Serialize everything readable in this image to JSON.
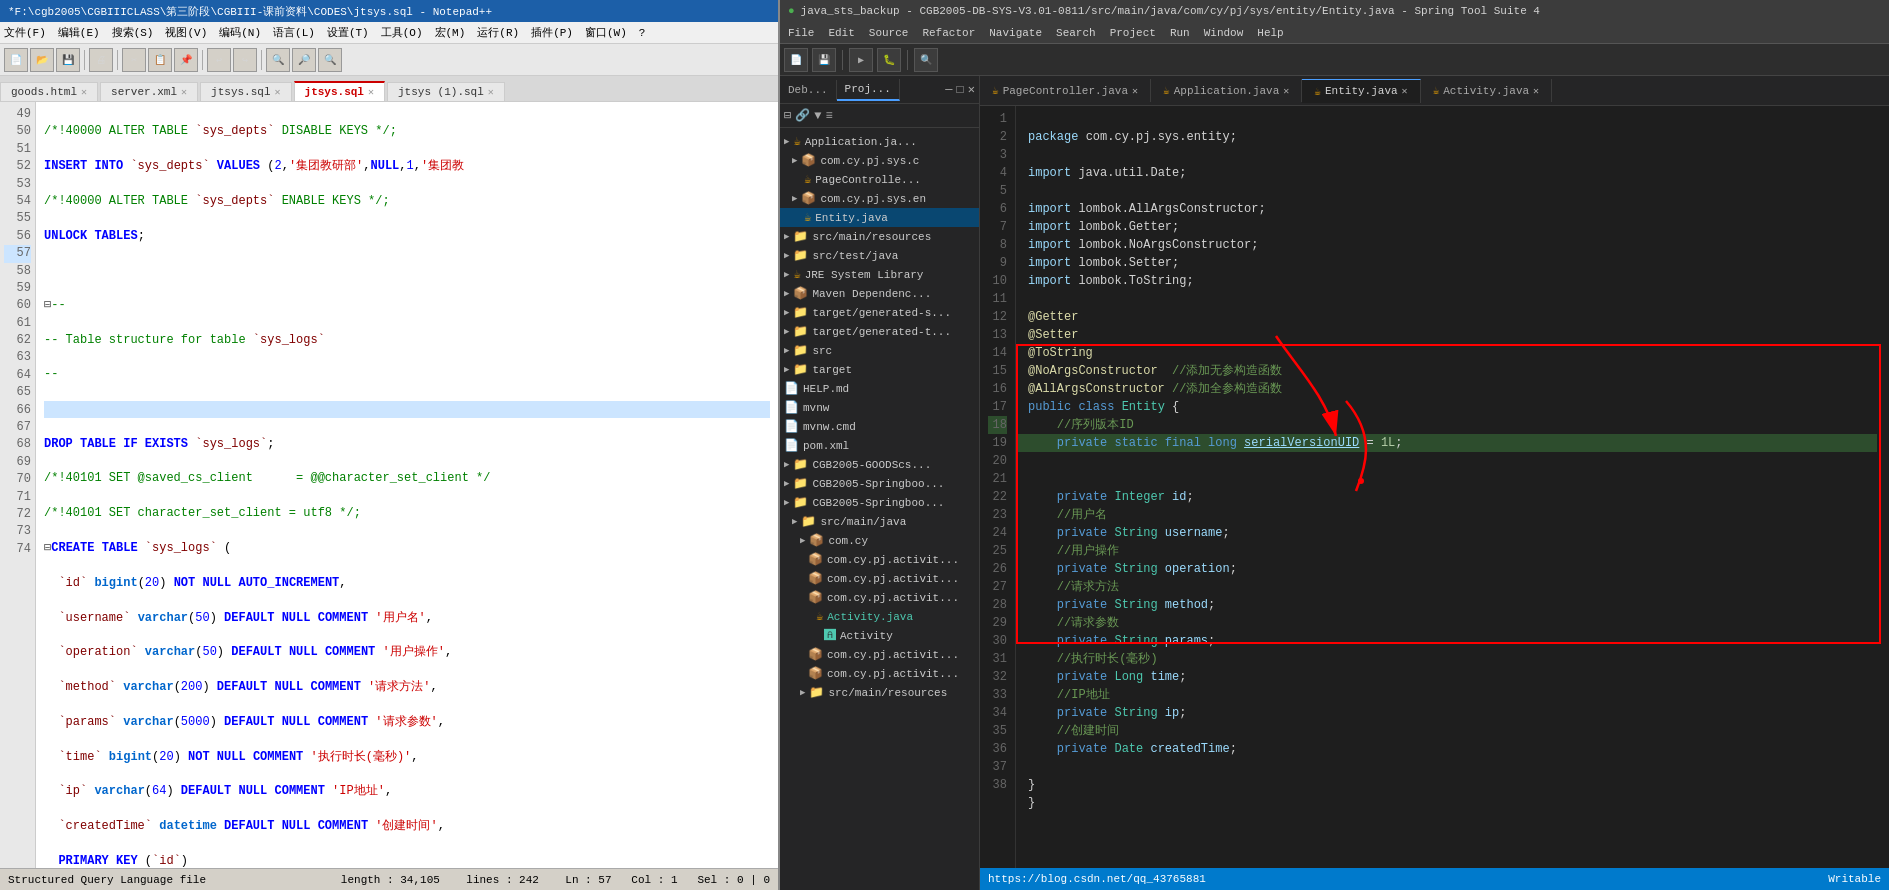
{
  "leftPanel": {
    "titlebar": "*F:\\cgb2005\\CGBIIICLASS\\第三阶段\\CGBIII-课前资料\\CODES\\jtsys.sql - Notepad++",
    "menu": [
      "文件(F)",
      "编辑(E)",
      "搜索(S)",
      "视图(V)",
      "编码(N)",
      "语言(L)",
      "设置(T)",
      "工具(O)",
      "宏(M)",
      "运行(R)",
      "插件(P)",
      "窗口(W)",
      "?"
    ],
    "tabs": [
      {
        "label": "goods.html",
        "active": false
      },
      {
        "label": "server.xml",
        "active": false
      },
      {
        "label": "jtsys.sql",
        "active": false
      },
      {
        "label": "jtsys.sql",
        "active": true,
        "color": "red"
      },
      {
        "label": "jtsys (1).sql",
        "active": false
      }
    ],
    "statusbar": {
      "filetype": "Structured Query Language file",
      "length": "length : 34,105",
      "lines": "lines : 242",
      "ln": "Ln : 57",
      "col": "Col : 1",
      "sel": "Sel : 0 | 0"
    },
    "codeLines": [
      {
        "num": "49",
        "content": "/*!40000 ALTER TABLE `sys_depts` DISABLE KEYS */;",
        "type": "comment"
      },
      {
        "num": "50",
        "content": "INSERT INTO `sys_depts` VALUES (2,'集团教研部',NULL,1,'集团教",
        "type": "mixed"
      },
      {
        "num": "51",
        "content": "/*!40000 ALTER TABLE `sys_depts` ENABLE KEYS */;",
        "type": "comment"
      },
      {
        "num": "52",
        "content": "UNLOCK TABLES;",
        "type": "kw"
      },
      {
        "num": "53",
        "content": "",
        "type": "blank"
      },
      {
        "num": "54",
        "content": "--",
        "type": "comment",
        "fold": true
      },
      {
        "num": "55",
        "content": "-- Table structure for table `sys_logs`",
        "type": "comment"
      },
      {
        "num": "56",
        "content": "--",
        "type": "comment"
      },
      {
        "num": "57",
        "content": "",
        "type": "blank",
        "highlighted": true
      },
      {
        "num": "58",
        "content": "DROP TABLE IF EXISTS `sys_logs`;",
        "type": "kw"
      },
      {
        "num": "59",
        "content": "/*!40101 SET @saved_cs_client      = @@character_set_client */",
        "type": "comment"
      },
      {
        "num": "60",
        "content": "/*!40101 SET character_set_client = utf8 */;",
        "type": "comment"
      },
      {
        "num": "61",
        "content": "CREATE TABLE `sys_logs` (",
        "type": "kw",
        "fold": true
      },
      {
        "num": "62",
        "content": "  `id` bigint(20) NOT NULL AUTO_INCREMENT,",
        "type": "field"
      },
      {
        "num": "63",
        "content": "  `username` varchar(50) DEFAULT NULL COMMENT '用户名',",
        "type": "field"
      },
      {
        "num": "64",
        "content": "  `operation` varchar(50) DEFAULT NULL COMMENT '用户操作',",
        "type": "field"
      },
      {
        "num": "65",
        "content": "  `method` varchar(200) DEFAULT NULL COMMENT '请求方法',",
        "type": "field"
      },
      {
        "num": "66",
        "content": "  `params` varchar(5000) DEFAULT NULL COMMENT '请求参数',",
        "type": "field"
      },
      {
        "num": "67",
        "content": "  `time` bigint(20) NOT NULL COMMENT '执行时长(毫秒)',",
        "type": "field"
      },
      {
        "num": "68",
        "content": "  `ip` varchar(64) DEFAULT NULL COMMENT 'IP地址',",
        "type": "field"
      },
      {
        "num": "69",
        "content": "  `createdTime` datetime DEFAULT NULL COMMENT '创建时间',",
        "type": "field"
      },
      {
        "num": "70",
        "content": "  PRIMARY KEY (`id`)",
        "type": "field"
      },
      {
        "num": "71",
        "content": ") ENGINE=InnoDB AUTO_INCREMENT=175 DEFAULT CHARSET=utf8 COMME",
        "type": "field"
      },
      {
        "num": "72",
        "content": "/*!40101 SET character_set_client = @saved_cs_client */;",
        "type": "comment"
      },
      {
        "num": "73",
        "content": "",
        "type": "blank"
      },
      {
        "num": "74",
        "content": "--",
        "type": "comment",
        "fold": true
      }
    ]
  },
  "rightPanel": {
    "titlebar": "java_sts_backup - CGB2005-DB-SYS-V3.01-0811/src/main/java/com/cy/pj/sys/entity/Entity.java - Spring Tool Suite 4",
    "menu": [
      "File",
      "Edit",
      "Source",
      "Refactor",
      "Navigate",
      "Search",
      "Project",
      "Run",
      "Window",
      "Help"
    ],
    "editorTabs": [
      {
        "label": "Deb...",
        "active": false
      },
      {
        "label": "Proj...",
        "active": false
      },
      {
        "label": "PageController.java",
        "active": false
      },
      {
        "label": "Application.java",
        "active": false
      },
      {
        "label": "Entity.java",
        "active": true
      },
      {
        "label": "Activity.java",
        "active": false
      }
    ],
    "projectTree": [
      {
        "level": 0,
        "label": "Application.ja...",
        "icon": "📄",
        "expanded": false
      },
      {
        "level": 1,
        "label": "com.cy.pj.sys.c",
        "icon": "📁",
        "expanded": false
      },
      {
        "level": 2,
        "label": "PageControlle...",
        "icon": "📄"
      },
      {
        "level": 1,
        "label": "com.cy.pj.sys.en",
        "icon": "📁",
        "expanded": false
      },
      {
        "level": 2,
        "label": "Entity.java",
        "icon": "📄",
        "active": true
      },
      {
        "level": 0,
        "label": "src/main/resources",
        "icon": "📁",
        "expanded": false
      },
      {
        "level": 0,
        "label": "src/test/java",
        "icon": "📁",
        "expanded": false
      },
      {
        "level": 0,
        "label": "JRE System Library",
        "icon": "📁"
      },
      {
        "level": 0,
        "label": "Maven Dependenc...",
        "icon": "📁"
      },
      {
        "level": 0,
        "label": "target/generated-s...",
        "icon": "📁"
      },
      {
        "level": 0,
        "label": "target/generated-t...",
        "icon": "📁"
      },
      {
        "level": 0,
        "label": "src",
        "icon": "📁"
      },
      {
        "level": 0,
        "label": "target",
        "icon": "📁"
      },
      {
        "level": 0,
        "label": "HELP.md",
        "icon": "📄"
      },
      {
        "level": 0,
        "label": "mvnw",
        "icon": "📄"
      },
      {
        "level": 0,
        "label": "mvnw.cmd",
        "icon": "📄"
      },
      {
        "level": 0,
        "label": "pom.xml",
        "icon": "📄"
      },
      {
        "level": 0,
        "label": "CGB2005-GOODScs...",
        "icon": "📁"
      },
      {
        "level": 0,
        "label": "CGB2005-Springboo...",
        "icon": "📁"
      },
      {
        "level": 0,
        "label": "CGB2005-Springboo...",
        "icon": "📁"
      },
      {
        "level": 1,
        "label": "src/main/java",
        "icon": "📁",
        "expanded": true
      },
      {
        "level": 2,
        "label": "com.cy",
        "icon": "📁",
        "expanded": false
      },
      {
        "level": 3,
        "label": "com.cy.pj.activit...",
        "icon": "📁"
      },
      {
        "level": 3,
        "label": "com.cy.pj.activit...",
        "icon": "📁"
      },
      {
        "level": 3,
        "label": "com.cy.pj.activit...",
        "icon": "📁"
      },
      {
        "level": 3,
        "label": "Activity.java",
        "icon": "📄",
        "selected": true
      },
      {
        "level": 4,
        "label": "Activity",
        "icon": "🅰"
      },
      {
        "level": 3,
        "label": "com.cy.pj.activit...",
        "icon": "📁"
      },
      {
        "level": 3,
        "label": "com.cy.pj.activit...",
        "icon": "📁"
      },
      {
        "level": 1,
        "label": "src/main/resources",
        "icon": "📁"
      }
    ],
    "javaCode": [
      {
        "num": "1",
        "content": "package com.cy.pj.sys.entity;"
      },
      {
        "num": "2",
        "content": ""
      },
      {
        "num": "3",
        "content": "import java.util.Date;"
      },
      {
        "num": "4",
        "content": ""
      },
      {
        "num": "5",
        "content": "import lombok.AllArgsConstructor;"
      },
      {
        "num": "6",
        "content": "import lombok.Getter;"
      },
      {
        "num": "7",
        "content": "import lombok.NoArgsConstructor;"
      },
      {
        "num": "8",
        "content": "import lombok.Setter;"
      },
      {
        "num": "9",
        "content": "import lombok.ToString;"
      },
      {
        "num": "10",
        "content": ""
      },
      {
        "num": "11",
        "content": "@Getter"
      },
      {
        "num": "12",
        "content": "@Setter"
      },
      {
        "num": "13",
        "content": "@ToString"
      },
      {
        "num": "14",
        "content": "@NoArgsConstructor  //添加无参构造函数"
      },
      {
        "num": "15",
        "content": "@AllArgsConstructor //添加全参构造函数"
      },
      {
        "num": "16",
        "content": "public class Entity {"
      },
      {
        "num": "17",
        "content": "    //序列版本ID"
      },
      {
        "num": "18",
        "content": "    private static final long serialVersionUID = 1L;",
        "highlighted": true
      },
      {
        "num": "19",
        "content": ""
      },
      {
        "num": "20",
        "content": "    private Integer id;"
      },
      {
        "num": "21",
        "content": "    //用户名"
      },
      {
        "num": "22",
        "content": "    private String username;"
      },
      {
        "num": "23",
        "content": "    //用户操作"
      },
      {
        "num": "24",
        "content": "    private String operation;"
      },
      {
        "num": "25",
        "content": "    //请求方法"
      },
      {
        "num": "26",
        "content": "    private String method;"
      },
      {
        "num": "27",
        "content": "    //请求参数"
      },
      {
        "num": "28",
        "content": "    private String params;"
      },
      {
        "num": "29",
        "content": "    //执行时长(毫秒)"
      },
      {
        "num": "30",
        "content": "    private Long time;"
      },
      {
        "num": "31",
        "content": "    //IP地址"
      },
      {
        "num": "32",
        "content": "    private String ip;"
      },
      {
        "num": "33",
        "content": "    //创建时间"
      },
      {
        "num": "34",
        "content": "    private Date createdTime;"
      },
      {
        "num": "35",
        "content": ""
      },
      {
        "num": "36",
        "content": "}"
      },
      {
        "num": "37",
        "content": "}"
      }
    ],
    "statusbar": {
      "url": "https://blog.csdn.net/qq_43765881",
      "right": "Writable"
    }
  }
}
